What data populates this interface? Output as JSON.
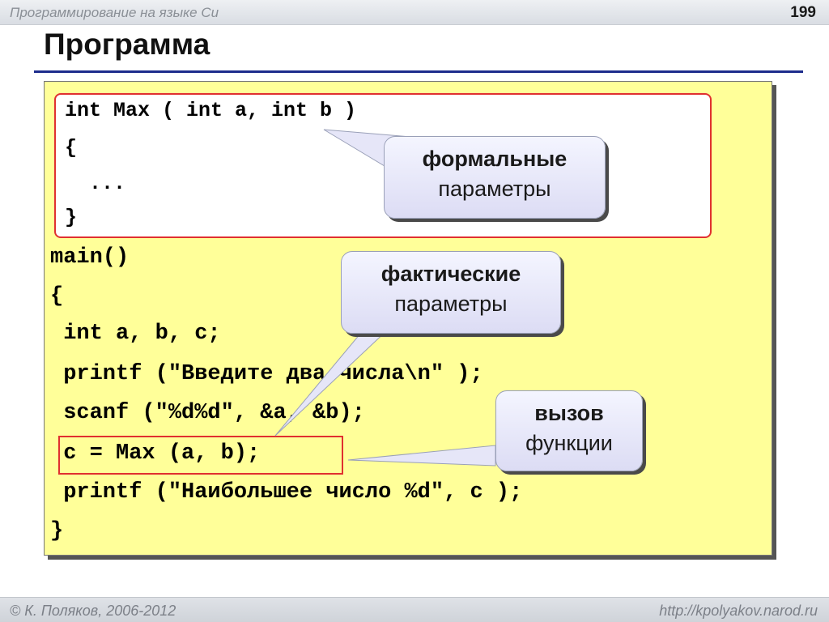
{
  "header": {
    "course": "Программирование на языке Си",
    "page_number": "199"
  },
  "slide": {
    "title": "Программа"
  },
  "code": {
    "func_lines": [
      "int Max ( int a, int b )",
      "{",
      "  ...",
      "}"
    ],
    "main_lines": [
      "main()",
      "{",
      " int a, b, c;",
      " printf (\"Введите два числа\\n\" );",
      " scanf (\"%d%d\", &a, &b);",
      " c = Max (a, b);",
      " printf (\"Наибольшее число %d\", c );",
      "}"
    ]
  },
  "callouts": {
    "formal": {
      "bold": "формальные",
      "normal": "параметры"
    },
    "actual": {
      "bold": "фактические",
      "normal": "параметры"
    },
    "call": {
      "bold": "вызов",
      "normal": "функции"
    }
  },
  "colors": {
    "code_background": "#ffff99",
    "rule": "#1d2c8c",
    "highlight_border": "#e03030",
    "callout_fill": "#e6e6f8"
  },
  "footer": {
    "copyright": "© К. Поляков, 2006-2012",
    "site": "http://kpolyakov.narod.ru"
  }
}
